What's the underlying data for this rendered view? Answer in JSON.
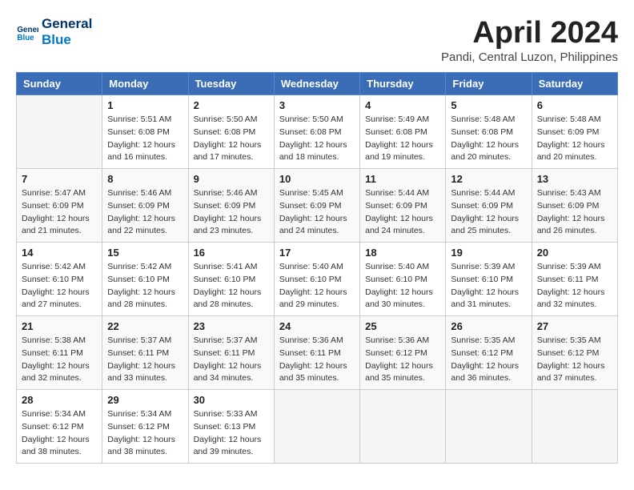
{
  "header": {
    "logo_line1": "General",
    "logo_line2": "Blue",
    "month": "April 2024",
    "location": "Pandi, Central Luzon, Philippines"
  },
  "weekdays": [
    "Sunday",
    "Monday",
    "Tuesday",
    "Wednesday",
    "Thursday",
    "Friday",
    "Saturday"
  ],
  "weeks": [
    [
      {
        "day": "",
        "sunrise": "",
        "sunset": "",
        "daylight": "",
        "empty": true
      },
      {
        "day": "1",
        "sunrise": "Sunrise: 5:51 AM",
        "sunset": "Sunset: 6:08 PM",
        "daylight": "Daylight: 12 hours and 16 minutes.",
        "empty": false
      },
      {
        "day": "2",
        "sunrise": "Sunrise: 5:50 AM",
        "sunset": "Sunset: 6:08 PM",
        "daylight": "Daylight: 12 hours and 17 minutes.",
        "empty": false
      },
      {
        "day": "3",
        "sunrise": "Sunrise: 5:50 AM",
        "sunset": "Sunset: 6:08 PM",
        "daylight": "Daylight: 12 hours and 18 minutes.",
        "empty": false
      },
      {
        "day": "4",
        "sunrise": "Sunrise: 5:49 AM",
        "sunset": "Sunset: 6:08 PM",
        "daylight": "Daylight: 12 hours and 19 minutes.",
        "empty": false
      },
      {
        "day": "5",
        "sunrise": "Sunrise: 5:48 AM",
        "sunset": "Sunset: 6:08 PM",
        "daylight": "Daylight: 12 hours and 20 minutes.",
        "empty": false
      },
      {
        "day": "6",
        "sunrise": "Sunrise: 5:48 AM",
        "sunset": "Sunset: 6:09 PM",
        "daylight": "Daylight: 12 hours and 20 minutes.",
        "empty": false
      }
    ],
    [
      {
        "day": "7",
        "sunrise": "Sunrise: 5:47 AM",
        "sunset": "Sunset: 6:09 PM",
        "daylight": "Daylight: 12 hours and 21 minutes.",
        "empty": false
      },
      {
        "day": "8",
        "sunrise": "Sunrise: 5:46 AM",
        "sunset": "Sunset: 6:09 PM",
        "daylight": "Daylight: 12 hours and 22 minutes.",
        "empty": false
      },
      {
        "day": "9",
        "sunrise": "Sunrise: 5:46 AM",
        "sunset": "Sunset: 6:09 PM",
        "daylight": "Daylight: 12 hours and 23 minutes.",
        "empty": false
      },
      {
        "day": "10",
        "sunrise": "Sunrise: 5:45 AM",
        "sunset": "Sunset: 6:09 PM",
        "daylight": "Daylight: 12 hours and 24 minutes.",
        "empty": false
      },
      {
        "day": "11",
        "sunrise": "Sunrise: 5:44 AM",
        "sunset": "Sunset: 6:09 PM",
        "daylight": "Daylight: 12 hours and 24 minutes.",
        "empty": false
      },
      {
        "day": "12",
        "sunrise": "Sunrise: 5:44 AM",
        "sunset": "Sunset: 6:09 PM",
        "daylight": "Daylight: 12 hours and 25 minutes.",
        "empty": false
      },
      {
        "day": "13",
        "sunrise": "Sunrise: 5:43 AM",
        "sunset": "Sunset: 6:09 PM",
        "daylight": "Daylight: 12 hours and 26 minutes.",
        "empty": false
      }
    ],
    [
      {
        "day": "14",
        "sunrise": "Sunrise: 5:42 AM",
        "sunset": "Sunset: 6:10 PM",
        "daylight": "Daylight: 12 hours and 27 minutes.",
        "empty": false
      },
      {
        "day": "15",
        "sunrise": "Sunrise: 5:42 AM",
        "sunset": "Sunset: 6:10 PM",
        "daylight": "Daylight: 12 hours and 28 minutes.",
        "empty": false
      },
      {
        "day": "16",
        "sunrise": "Sunrise: 5:41 AM",
        "sunset": "Sunset: 6:10 PM",
        "daylight": "Daylight: 12 hours and 28 minutes.",
        "empty": false
      },
      {
        "day": "17",
        "sunrise": "Sunrise: 5:40 AM",
        "sunset": "Sunset: 6:10 PM",
        "daylight": "Daylight: 12 hours and 29 minutes.",
        "empty": false
      },
      {
        "day": "18",
        "sunrise": "Sunrise: 5:40 AM",
        "sunset": "Sunset: 6:10 PM",
        "daylight": "Daylight: 12 hours and 30 minutes.",
        "empty": false
      },
      {
        "day": "19",
        "sunrise": "Sunrise: 5:39 AM",
        "sunset": "Sunset: 6:10 PM",
        "daylight": "Daylight: 12 hours and 31 minutes.",
        "empty": false
      },
      {
        "day": "20",
        "sunrise": "Sunrise: 5:39 AM",
        "sunset": "Sunset: 6:11 PM",
        "daylight": "Daylight: 12 hours and 32 minutes.",
        "empty": false
      }
    ],
    [
      {
        "day": "21",
        "sunrise": "Sunrise: 5:38 AM",
        "sunset": "Sunset: 6:11 PM",
        "daylight": "Daylight: 12 hours and 32 minutes.",
        "empty": false
      },
      {
        "day": "22",
        "sunrise": "Sunrise: 5:37 AM",
        "sunset": "Sunset: 6:11 PM",
        "daylight": "Daylight: 12 hours and 33 minutes.",
        "empty": false
      },
      {
        "day": "23",
        "sunrise": "Sunrise: 5:37 AM",
        "sunset": "Sunset: 6:11 PM",
        "daylight": "Daylight: 12 hours and 34 minutes.",
        "empty": false
      },
      {
        "day": "24",
        "sunrise": "Sunrise: 5:36 AM",
        "sunset": "Sunset: 6:11 PM",
        "daylight": "Daylight: 12 hours and 35 minutes.",
        "empty": false
      },
      {
        "day": "25",
        "sunrise": "Sunrise: 5:36 AM",
        "sunset": "Sunset: 6:12 PM",
        "daylight": "Daylight: 12 hours and 35 minutes.",
        "empty": false
      },
      {
        "day": "26",
        "sunrise": "Sunrise: 5:35 AM",
        "sunset": "Sunset: 6:12 PM",
        "daylight": "Daylight: 12 hours and 36 minutes.",
        "empty": false
      },
      {
        "day": "27",
        "sunrise": "Sunrise: 5:35 AM",
        "sunset": "Sunset: 6:12 PM",
        "daylight": "Daylight: 12 hours and 37 minutes.",
        "empty": false
      }
    ],
    [
      {
        "day": "28",
        "sunrise": "Sunrise: 5:34 AM",
        "sunset": "Sunset: 6:12 PM",
        "daylight": "Daylight: 12 hours and 38 minutes.",
        "empty": false
      },
      {
        "day": "29",
        "sunrise": "Sunrise: 5:34 AM",
        "sunset": "Sunset: 6:12 PM",
        "daylight": "Daylight: 12 hours and 38 minutes.",
        "empty": false
      },
      {
        "day": "30",
        "sunrise": "Sunrise: 5:33 AM",
        "sunset": "Sunset: 6:13 PM",
        "daylight": "Daylight: 12 hours and 39 minutes.",
        "empty": false
      },
      {
        "day": "",
        "sunrise": "",
        "sunset": "",
        "daylight": "",
        "empty": true
      },
      {
        "day": "",
        "sunrise": "",
        "sunset": "",
        "daylight": "",
        "empty": true
      },
      {
        "day": "",
        "sunrise": "",
        "sunset": "",
        "daylight": "",
        "empty": true
      },
      {
        "day": "",
        "sunrise": "",
        "sunset": "",
        "daylight": "",
        "empty": true
      }
    ]
  ]
}
